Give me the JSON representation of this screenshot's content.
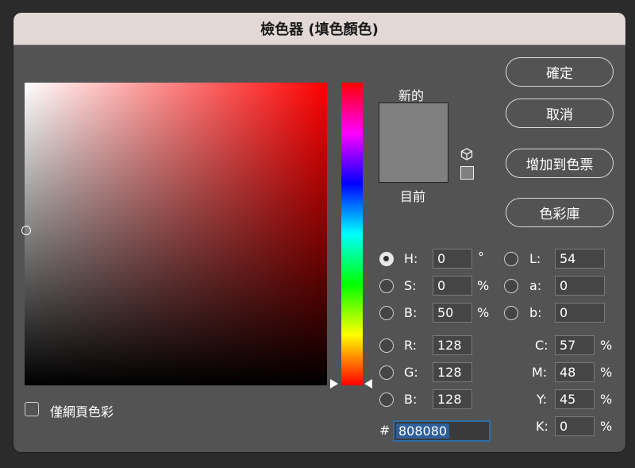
{
  "title": "檢色器 (填色顏色)",
  "preview": {
    "new_label": "新的",
    "current_label": "目前",
    "color": "#808080",
    "gamut_icon": "cube-icon",
    "websafe_icon": "websafe-square-icon"
  },
  "buttons": {
    "ok": "確定",
    "cancel": "取消",
    "add_to_swatches": "增加到色票",
    "color_libraries": "色彩庫"
  },
  "hsb": {
    "h": {
      "label": "H:",
      "value": "0",
      "unit": "°",
      "selected": true
    },
    "s": {
      "label": "S:",
      "value": "0",
      "unit": "%",
      "selected": false
    },
    "b": {
      "label": "B:",
      "value": "50",
      "unit": "%",
      "selected": false
    }
  },
  "rgb": {
    "r": {
      "label": "R:",
      "value": "128"
    },
    "g": {
      "label": "G:",
      "value": "128"
    },
    "b": {
      "label": "B:",
      "value": "128"
    }
  },
  "lab": {
    "l": {
      "label": "L:",
      "value": "54"
    },
    "a": {
      "label": "a:",
      "value": "0"
    },
    "b": {
      "label": "b:",
      "value": "0"
    }
  },
  "cmyk": {
    "c": {
      "label": "C:",
      "value": "57",
      "unit": "%"
    },
    "m": {
      "label": "M:",
      "value": "48",
      "unit": "%"
    },
    "y": {
      "label": "Y:",
      "value": "45",
      "unit": "%"
    },
    "k": {
      "label": "K:",
      "value": "0",
      "unit": "%"
    }
  },
  "hex": {
    "label": "#",
    "value": "808080"
  },
  "web_only": {
    "label": "僅網頁色彩",
    "checked": false
  }
}
